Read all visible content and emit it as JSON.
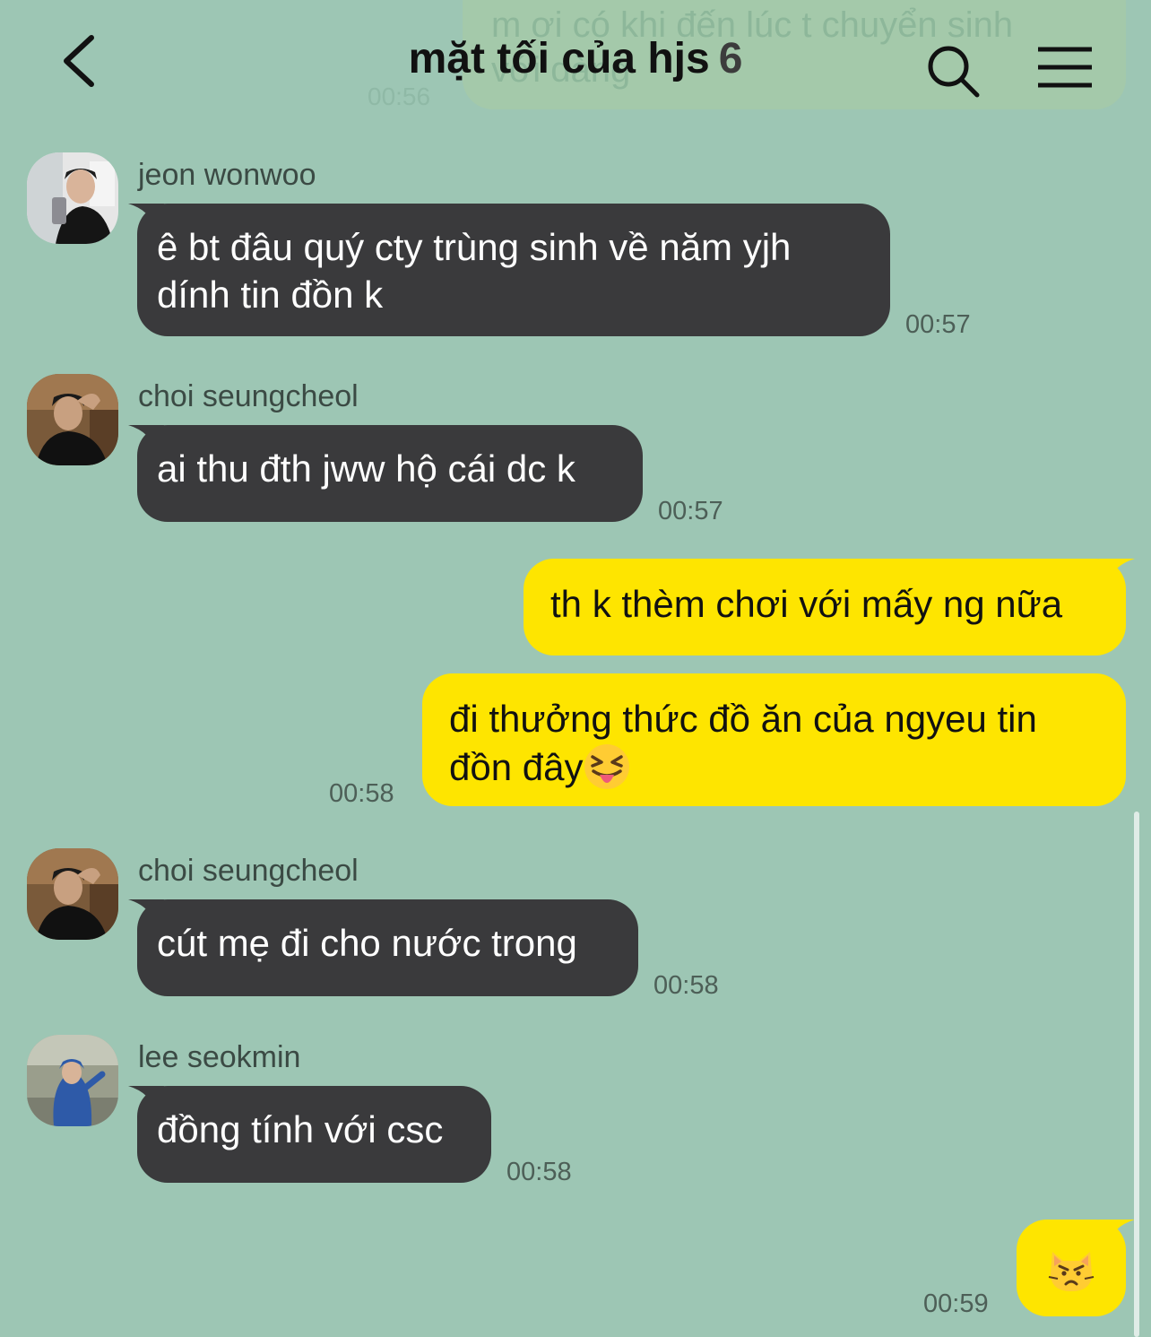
{
  "header": {
    "title": "mặt tối của hjs",
    "member_count": "6",
    "prev_message_preview_line1": "m ơi có khi đến lúc t chuyển sinh",
    "prev_message_preview_line2": "với dàng",
    "prev_message_time": "00:56"
  },
  "messages": [
    {
      "sender": "jeon wonwoo",
      "line1": "ê bt đâu quý cty trùng sinh về năm yjh",
      "line2": "dính tin đồn k",
      "time": "00:57"
    },
    {
      "sender": "choi seungcheol",
      "text": "ai thu đth jww hộ cái dc k",
      "time": "00:57"
    },
    {
      "from_me": true,
      "text": "th k thèm chơi với mấy ng nữa"
    },
    {
      "from_me": true,
      "line1": "đi thưởng thức đồ ăn của ngyeu tin",
      "line2": "đồn đây",
      "emoji": "squinting-tongue-face",
      "time": "00:58"
    },
    {
      "sender": "choi seungcheol",
      "text": "cút mẹ đi cho nước trong",
      "time": "00:58"
    },
    {
      "sender": "lee seokmin",
      "text": "đồng tính với csc",
      "time": "00:58"
    },
    {
      "from_me": true,
      "emoji": "pouting-cat-face",
      "time": "00:59"
    }
  ],
  "colors": {
    "background": "#9dc6b4",
    "incoming_bubble": "#3a3a3c",
    "outgoing_bubble": "#fee500"
  }
}
